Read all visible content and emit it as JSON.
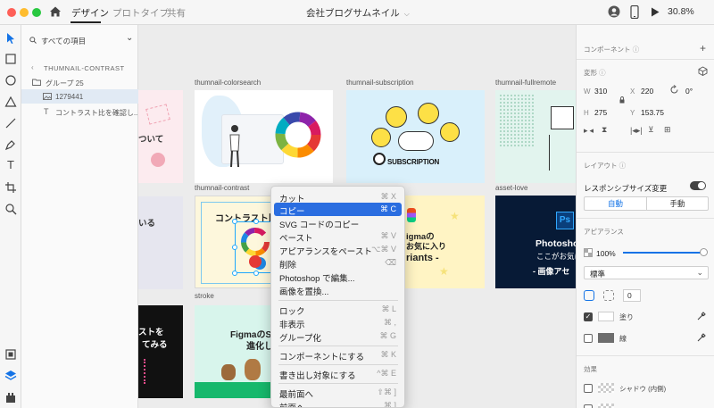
{
  "topbar": {
    "tabs": [
      {
        "label": "デザイン"
      },
      {
        "label": "プロトタイプ"
      },
      {
        "label": "共有"
      }
    ],
    "document_title": "会社ブログサムネイル",
    "zoom": "30.8%"
  },
  "layers": {
    "search_placeholder": "すべての項目",
    "artboard_name": "THUMNAIL-CONTRAST",
    "group_name": "グループ 25",
    "image_name": "1279441",
    "text_name": "コントラスト比を確認し..."
  },
  "canvas": {
    "artboards": [
      {
        "label": "thumnail-colorsearch"
      },
      {
        "label": "thumnail-subscription"
      },
      {
        "label": "thumnail-fullremote"
      },
      {
        "label": "thumnail-contrast"
      },
      {
        "label": "asset-love"
      },
      {
        "label": "stroke"
      }
    ],
    "texts": {
      "partial_left_top": "ついて",
      "partial_left_mid": "いる",
      "partial_left_bottom_1": "ストを",
      "partial_left_bottom_2": "てみる",
      "subscription_caption": "SUBSCRIPTION",
      "contrast_title": "コントラスト比を",
      "figma_line1": "igmaの",
      "figma_line2": "お気に入り",
      "figma_line3": "riants -",
      "ps_badge": "Ps",
      "ps_title": "Photoshop",
      "ps_sub": "ここがお気に",
      "ps_sub2": "- 画像アセ",
      "stroke_line1": "FigmaのSt",
      "stroke_line2": "進化し"
    }
  },
  "context_menu": {
    "items": [
      {
        "label": "カット",
        "shortcut": "⌘ X"
      },
      {
        "label": "コピー",
        "shortcut": "⌘ C"
      },
      {
        "label": "SVG コードのコピー",
        "shortcut": ""
      },
      {
        "label": "ペースト",
        "shortcut": "⌘ V"
      },
      {
        "label": "アピアランスをペースト",
        "shortcut": "⌥⌘ V"
      },
      {
        "label": "削除",
        "shortcut": "⌫"
      },
      {
        "label": "Photoshop で編集...",
        "shortcut": ""
      },
      {
        "label": "画像を置換...",
        "shortcut": ""
      },
      {
        "label": "ロック",
        "shortcut": "⌘ L"
      },
      {
        "label": "非表示",
        "shortcut": "⌘ ,"
      },
      {
        "label": "グループ化",
        "shortcut": "⌘ G"
      },
      {
        "label": "コンポーネントにする",
        "shortcut": "⌘ K"
      },
      {
        "label": "書き出し対象にする",
        "shortcut": "^⌘ E"
      },
      {
        "label": "最前面へ",
        "shortcut": "⇧⌘ ]"
      },
      {
        "label": "前面へ",
        "shortcut": "⌘ ]"
      }
    ],
    "highlighted_index": 1
  },
  "properties": {
    "component_label": "コンポーネント",
    "transform_label": "変形",
    "w": "310",
    "x": "220",
    "rotation": "0°",
    "h": "275",
    "y": "153.75",
    "layout_label": "レイアウト",
    "responsive_label": "レスポンシブサイズ変更",
    "auto_label": "自動",
    "manual_label": "手動",
    "appearance_label": "アピアランス",
    "opacity": "100%",
    "blend": "標準",
    "corner_radius": "0",
    "fill_label": "塗り",
    "stroke_label": "線",
    "effects_label": "効果",
    "shadow_label": "シャドウ (内側)"
  },
  "colors": {
    "accent": "#2a6de0",
    "selection": "#1ea7fd"
  }
}
